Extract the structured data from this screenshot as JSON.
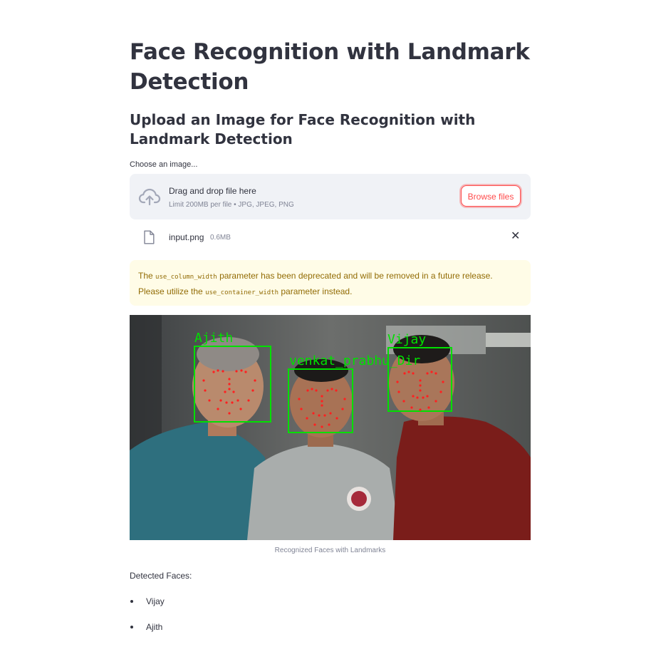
{
  "page": {
    "title": "Face Recognition with Landmark Detection",
    "subheader": "Upload an Image for Face Recognition with Landmark Detection"
  },
  "uploader": {
    "label": "Choose an image...",
    "drag_text": "Drag and drop file here",
    "limit_text": "Limit 200MB per file • JPG, JPEG, PNG",
    "browse_label": "Browse files",
    "upload_icon": "cloud-upload-icon",
    "file": {
      "name": "input.png",
      "size": "0.6MB",
      "icon": "file-icon",
      "remove_icon": "close-icon",
      "remove_symbol": "✕"
    }
  },
  "warning": {
    "prefix": "The",
    "code1": "use_column_width",
    "middle": "parameter has been deprecated and will be removed in a future release. Please utilize the",
    "code2": "use_container_width",
    "suffix": "parameter instead."
  },
  "result_image": {
    "caption": "Recognized Faces with Landmarks",
    "face_labels": [
      "Ajith",
      "venkat_prabhu_Dir",
      "Vijay"
    ],
    "box_color": "#00e000",
    "landmark_color": "#ff0000"
  },
  "detected": {
    "label": "Detected Faces:",
    "faces": [
      "Vijay",
      "Ajith"
    ]
  },
  "colors": {
    "accent": "#ff4b4b",
    "warning_bg": "#fffce7",
    "warning_text": "#926c05",
    "text": "#31333f",
    "muted": "#808495"
  }
}
